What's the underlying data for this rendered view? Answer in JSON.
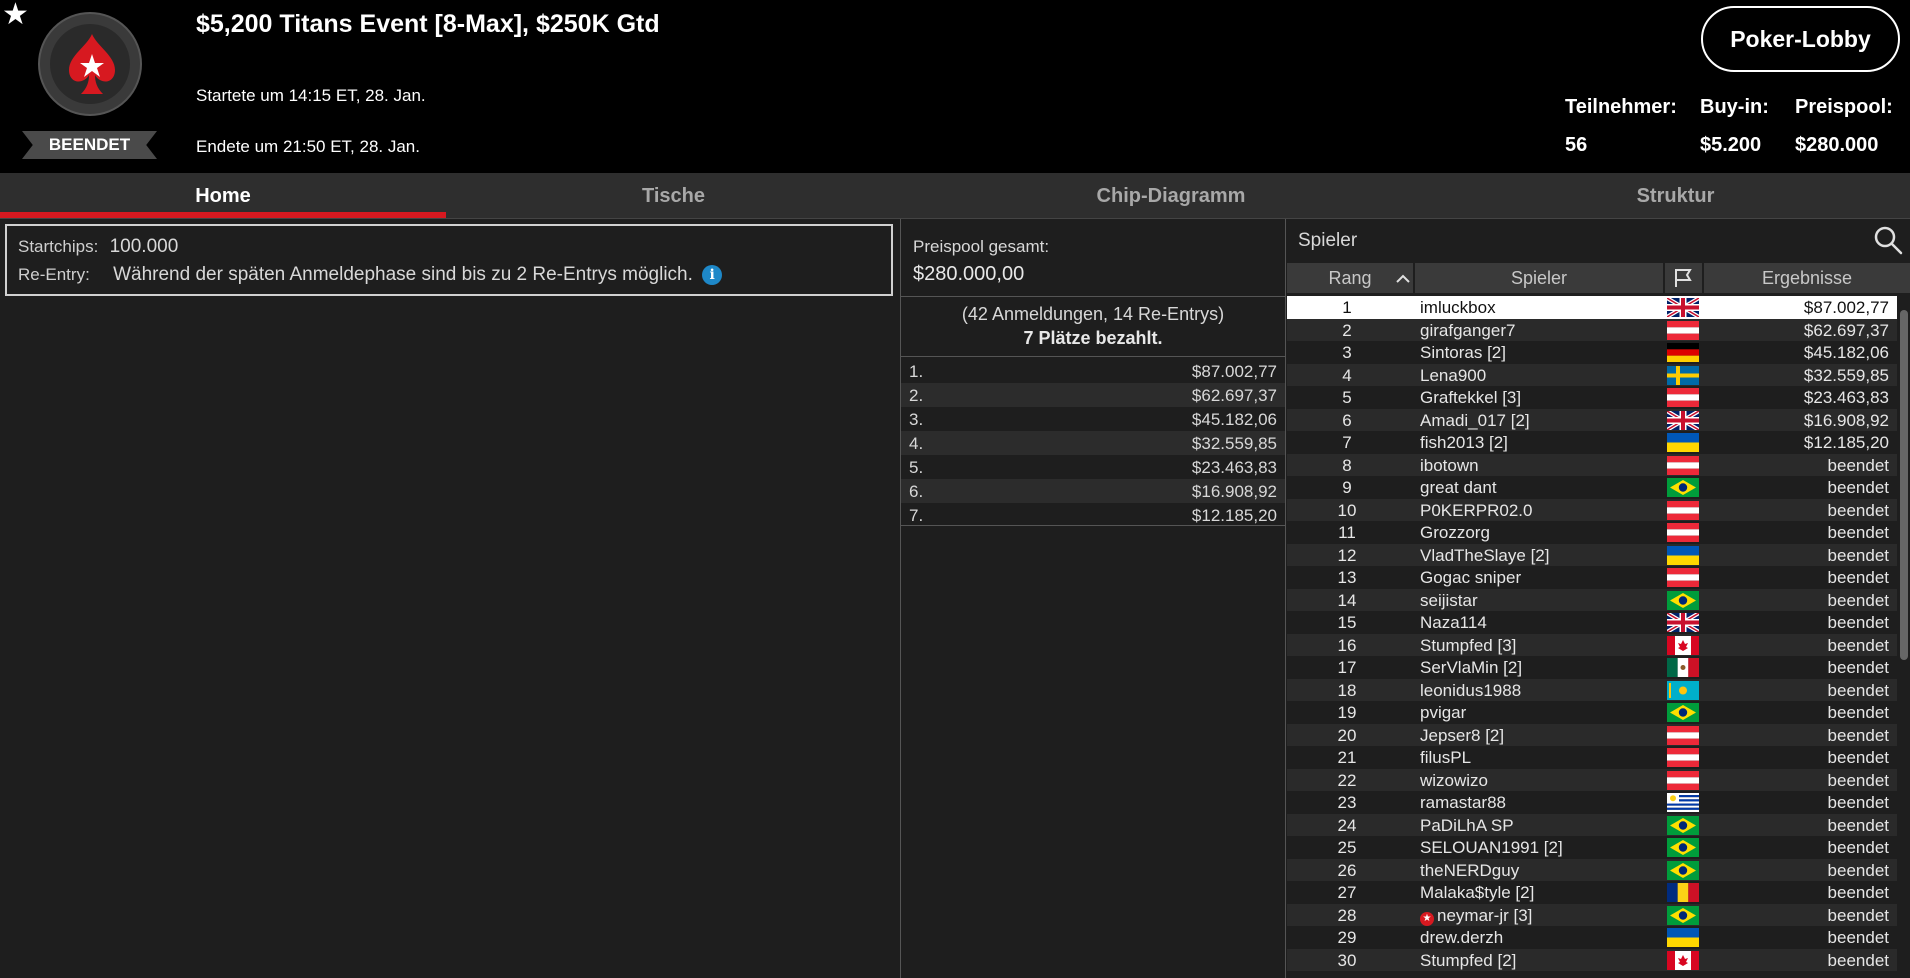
{
  "header": {
    "title": "$5,200 Titans Event [8-Max], $250K Gtd",
    "started": "Startete um 14:15 ET, 28. Jan.",
    "ended": "Endete um 21:50 ET, 28. Jan.",
    "status": "BEENDET",
    "lobby_button": "Poker-Lobby",
    "stats": {
      "participants_label": "Teilnehmer:",
      "participants_value": "56",
      "buyin_label": "Buy-in:",
      "buyin_value": "$5.200",
      "prizepool_label": "Preispool:",
      "prizepool_value": "$280.000"
    }
  },
  "tabs": [
    "Home",
    "Tische",
    "Chip-Diagramm",
    "Struktur"
  ],
  "info": {
    "startchips_label": "Startchips:",
    "startchips_value": "100.000",
    "reentry_label": "Re-Entry:",
    "reentry_value": "Während der späten Anmeldephase sind bis zu 2 Re-Entrys möglich.",
    "info_glyph": "i"
  },
  "prize": {
    "label": "Preispool gesamt:",
    "amount": "$280.000,00",
    "entries": "(42 Anmeldungen, 14 Re-Entrys)",
    "paid": "7 Plätze bezahlt.",
    "places": [
      {
        "place": "1.",
        "amount": "$87.002,77"
      },
      {
        "place": "2.",
        "amount": "$62.697,37"
      },
      {
        "place": "3.",
        "amount": "$45.182,06"
      },
      {
        "place": "4.",
        "amount": "$32.559,85"
      },
      {
        "place": "5.",
        "amount": "$23.463,83"
      },
      {
        "place": "6.",
        "amount": "$16.908,92"
      },
      {
        "place": "7.",
        "amount": "$12.185,20"
      }
    ]
  },
  "players": {
    "search_label": "Spieler",
    "columns": {
      "rank": "Rang",
      "player": "Spieler",
      "result": "Ergebnisse"
    },
    "rows": [
      {
        "rank": "1",
        "name": "imluckbox",
        "flag": "gb",
        "result": "$87.002,77"
      },
      {
        "rank": "2",
        "name": "girafganger7",
        "flag": "at",
        "result": "$62.697,37"
      },
      {
        "rank": "3",
        "name": "Sintoras [2]",
        "flag": "de",
        "result": "$45.182,06"
      },
      {
        "rank": "4",
        "name": "Lena900",
        "flag": "se",
        "result": "$32.559,85"
      },
      {
        "rank": "5",
        "name": "Graftekkel [3]",
        "flag": "at",
        "result": "$23.463,83"
      },
      {
        "rank": "6",
        "name": "Amadi_017 [2]",
        "flag": "gb",
        "result": "$16.908,92"
      },
      {
        "rank": "7",
        "name": "fish2013 [2]",
        "flag": "ua",
        "result": "$12.185,20"
      },
      {
        "rank": "8",
        "name": "ibotown",
        "flag": "at",
        "result": "beendet"
      },
      {
        "rank": "9",
        "name": "great dant",
        "flag": "br",
        "result": "beendet"
      },
      {
        "rank": "10",
        "name": "P0KERPR02.0",
        "flag": "at",
        "result": "beendet"
      },
      {
        "rank": "11",
        "name": "Grozzorg",
        "flag": "at",
        "result": "beendet"
      },
      {
        "rank": "12",
        "name": "VladTheSlaye [2]",
        "flag": "ua",
        "result": "beendet"
      },
      {
        "rank": "13",
        "name": "Gogac sniper",
        "flag": "at",
        "result": "beendet"
      },
      {
        "rank": "14",
        "name": "seijistar",
        "flag": "br",
        "result": "beendet"
      },
      {
        "rank": "15",
        "name": "Naza114",
        "flag": "gb",
        "result": "beendet"
      },
      {
        "rank": "16",
        "name": "Stumpfed [3]",
        "flag": "ca",
        "result": "beendet"
      },
      {
        "rank": "17",
        "name": "SerVlaMin [2]",
        "flag": "mx",
        "result": "beendet"
      },
      {
        "rank": "18",
        "name": "leonidus1988",
        "flag": "kz",
        "result": "beendet"
      },
      {
        "rank": "19",
        "name": "pvigar",
        "flag": "br",
        "result": "beendet"
      },
      {
        "rank": "20",
        "name": "Jepser8 [2]",
        "flag": "at",
        "result": "beendet"
      },
      {
        "rank": "21",
        "name": "filusPL",
        "flag": "at",
        "result": "beendet"
      },
      {
        "rank": "22",
        "name": "wizowizo",
        "flag": "at",
        "result": "beendet"
      },
      {
        "rank": "23",
        "name": "ramastar88",
        "flag": "uy",
        "result": "beendet"
      },
      {
        "rank": "24",
        "name": "PaDiLhA SP",
        "flag": "br",
        "result": "beendet"
      },
      {
        "rank": "25",
        "name": "SELOUAN1991 [2]",
        "flag": "br",
        "result": "beendet"
      },
      {
        "rank": "26",
        "name": "theNERDguy",
        "flag": "br",
        "result": "beendet"
      },
      {
        "rank": "27",
        "name": "Malaka$tyle [2]",
        "flag": "ro",
        "result": "beendet"
      },
      {
        "rank": "28",
        "name": "neymar-jr [3]",
        "flag": "br",
        "result": "beendet",
        "starred": true
      },
      {
        "rank": "29",
        "name": "drew.derzh",
        "flag": "ua",
        "result": "beendet"
      },
      {
        "rank": "30",
        "name": "Stumpfed [2]",
        "flag": "ca",
        "result": "beendet"
      }
    ]
  },
  "colors": {
    "accent": "#d71920",
    "info": "#1e88c8",
    "background": "#1e1e1e",
    "header": "#000000"
  }
}
